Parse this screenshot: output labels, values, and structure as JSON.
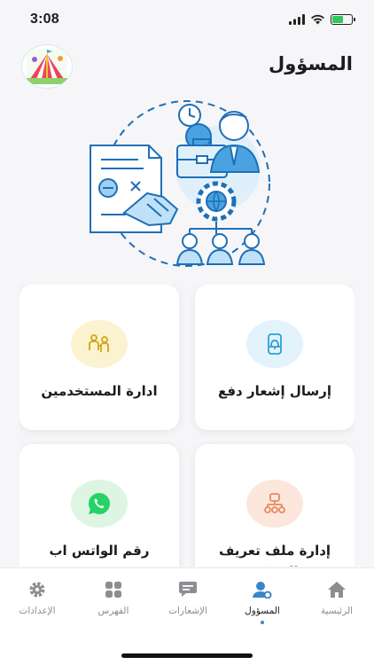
{
  "status": {
    "time": "3:08",
    "battery_level": 0.55
  },
  "header": {
    "title": "المسؤول",
    "logo_icon": "circus-tent-icon"
  },
  "hero": {
    "icon": "admin-management-illustration"
  },
  "cards": [
    {
      "label": "إرسال إشعار دفع",
      "icon": "bell-phone-icon",
      "icon_bg": "#e3f3fb",
      "icon_color": "#2a9fd6"
    },
    {
      "label": "ادارة المستخدمين",
      "icon": "users-icon",
      "icon_bg": "#fbf3cf",
      "icon_color": "#d4a416"
    },
    {
      "label": "إدارة ملف تعريف الشركة",
      "icon": "company-profile-icon",
      "icon_bg": "#fde6dc",
      "icon_color": "#e58a63"
    },
    {
      "label": "رقم الواتس اب",
      "icon": "whatsapp-icon",
      "icon_bg": "#dff5e4",
      "icon_color": "#25d366"
    }
  ],
  "tabs": [
    {
      "label": "الرئيسية",
      "icon": "home-icon",
      "active": false
    },
    {
      "label": "المسؤول",
      "icon": "admin-icon",
      "active": true
    },
    {
      "label": "الإشعارات",
      "icon": "chat-icon",
      "active": false
    },
    {
      "label": "الفهرس",
      "icon": "grid-icon",
      "active": false
    },
    {
      "label": "الإعدادات",
      "icon": "gear-icon",
      "active": false
    }
  ],
  "colors": {
    "accent": "#3a86c8",
    "illustration_bg": "#dff0fb",
    "illustration_line": "#1e6fb8"
  }
}
